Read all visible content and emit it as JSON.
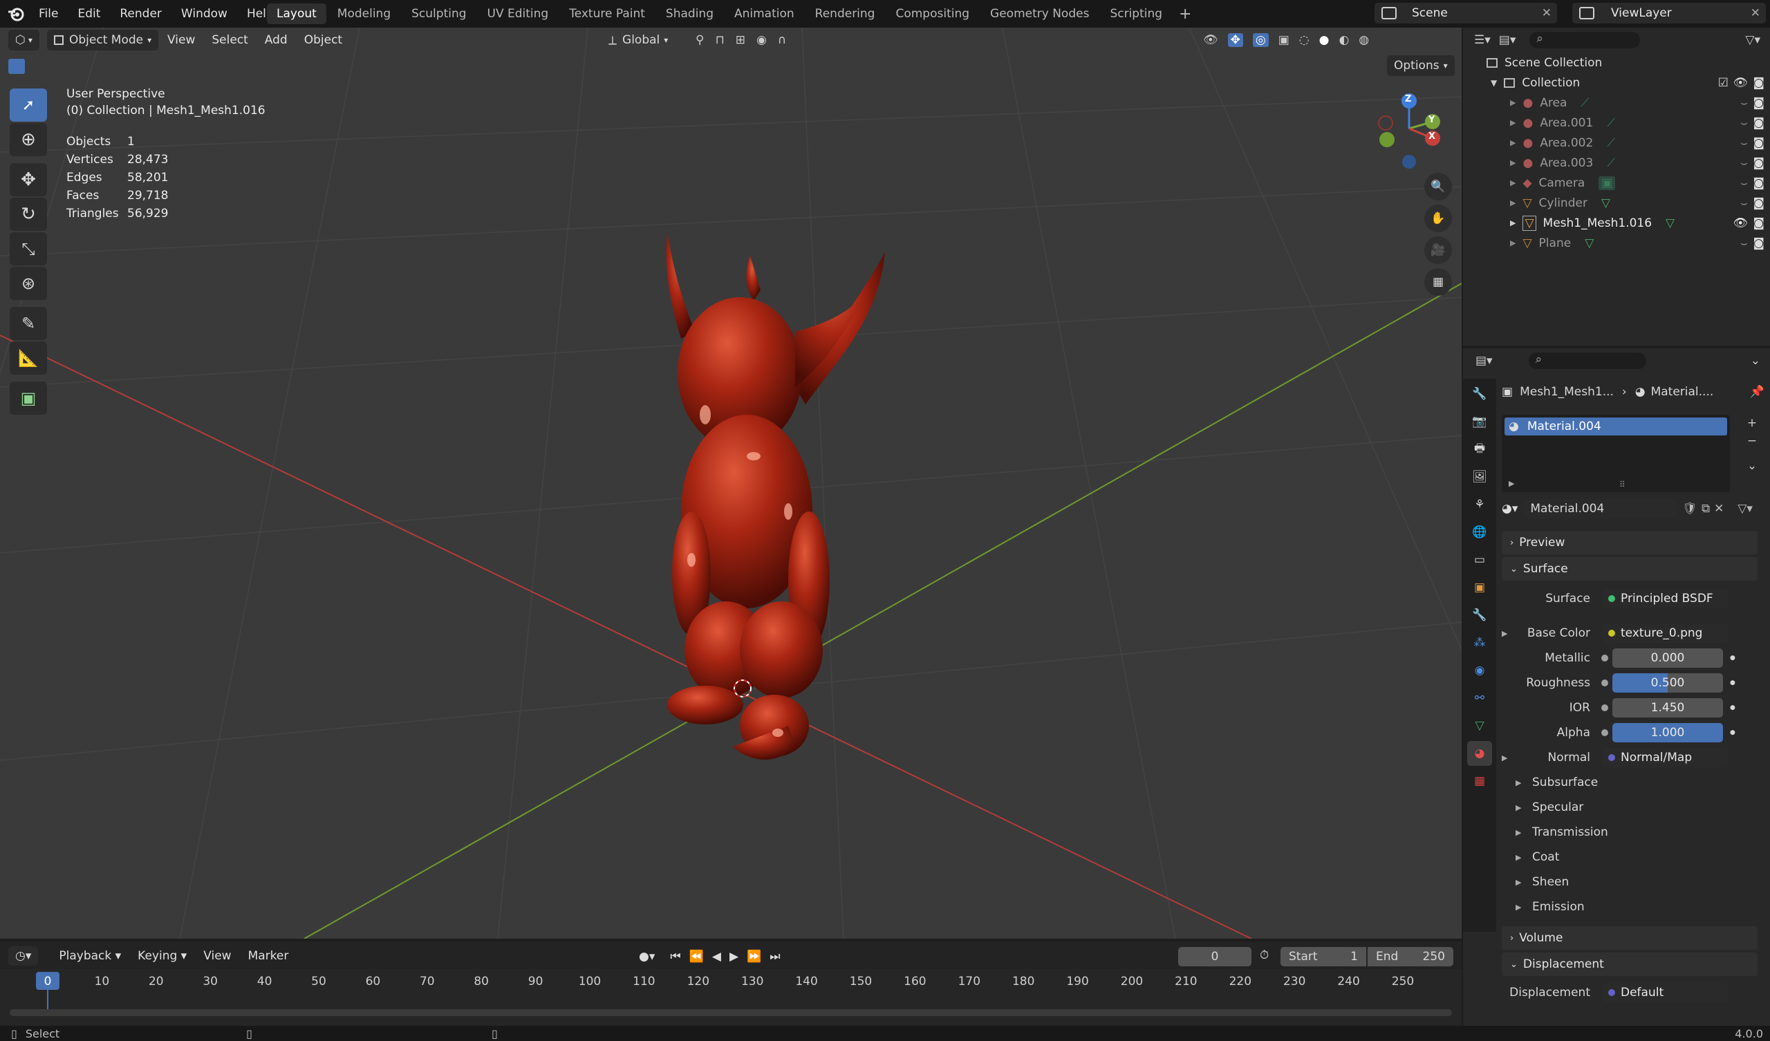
{
  "menu": [
    "File",
    "Edit",
    "Render",
    "Window",
    "Help"
  ],
  "workspaces": [
    "Layout",
    "Modeling",
    "Sculpting",
    "UV Editing",
    "Texture Paint",
    "Shading",
    "Animation",
    "Rendering",
    "Compositing",
    "Geometry Nodes",
    "Scripting"
  ],
  "scene": "Scene",
  "view_layer": "ViewLayer",
  "viewport": {
    "mode": "Object Mode",
    "menus": [
      "View",
      "Select",
      "Add",
      "Object"
    ],
    "orientation": "Global",
    "options": "Options",
    "perspective": "User Perspective",
    "collection_line": "(0) Collection | Mesh1_Mesh1.016",
    "stats": [
      {
        "k": "Objects",
        "v": "1"
      },
      {
        "k": "Vertices",
        "v": "28,473"
      },
      {
        "k": "Edges",
        "v": "58,201"
      },
      {
        "k": "Faces",
        "v": "29,718"
      },
      {
        "k": "Triangles",
        "v": "56,929"
      }
    ],
    "gizmo": {
      "z": "Z",
      "y": "Y",
      "x": "X"
    }
  },
  "outliner": {
    "root": "Scene Collection",
    "collection": "Collection",
    "items": [
      "Area",
      "Area.001",
      "Area.002",
      "Area.003",
      "Camera",
      "Cylinder",
      "Mesh1_Mesh1.016",
      "Plane"
    ]
  },
  "properties": {
    "breadcrumb_obj": "Mesh1_Mesh1...",
    "breadcrumb_mat": "Material....",
    "slot": "Material.004",
    "material_name": "Material.004",
    "panels": {
      "preview": "Preview",
      "surface": "Surface",
      "volume": "Volume",
      "displacement": "Displacement"
    },
    "surface_label": "Surface",
    "surface_value": "Principled BSDF",
    "base_color_label": "Base Color",
    "base_color_value": "texture_0.png",
    "metallic_label": "Metallic",
    "metallic": "0.000",
    "roughness_label": "Roughness",
    "roughness": "0.500",
    "ior_label": "IOR",
    "ior": "1.450",
    "alpha_label": "Alpha",
    "alpha": "1.000",
    "normal_label": "Normal",
    "normal_value": "Normal/Map",
    "subpanels": [
      "Subsurface",
      "Specular",
      "Transmission",
      "Coat",
      "Sheen",
      "Emission"
    ],
    "displacement_label": "Displacement",
    "displacement_value": "Default"
  },
  "timeline": {
    "menus": [
      "Playback",
      "Keying",
      "View",
      "Marker"
    ],
    "current": "0",
    "start_label": "Start",
    "start": "1",
    "end_label": "End",
    "end": "250",
    "ticks": [
      "0",
      "10",
      "20",
      "30",
      "40",
      "50",
      "60",
      "70",
      "80",
      "90",
      "100",
      "110",
      "120",
      "130",
      "140",
      "150",
      "160",
      "170",
      "180",
      "190",
      "200",
      "210",
      "220",
      "230",
      "240",
      "250"
    ]
  },
  "status": {
    "select": "Select",
    "version": "4.0.0"
  },
  "colors": {
    "accent": "#4772b3",
    "mesh": "#b02a15",
    "x_axis": "#c9403a",
    "y_axis": "#7aa53a",
    "z_axis": "#3f7fdc"
  }
}
